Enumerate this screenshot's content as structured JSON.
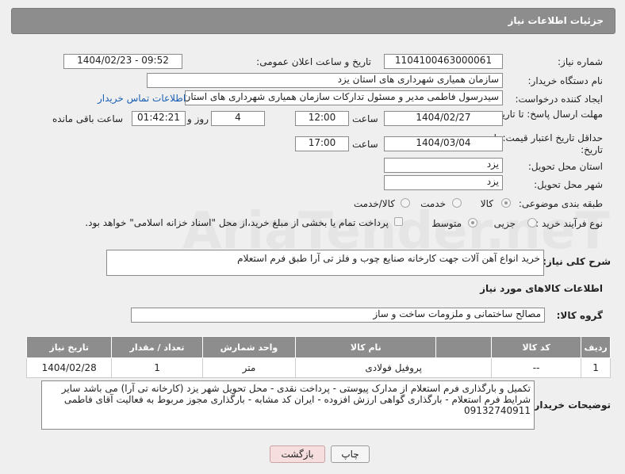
{
  "header": {
    "title": "جزئیات اطلاعات نیاز"
  },
  "watermark": "AriaTender.neT",
  "fields": {
    "need_number_label": "شماره نیاز:",
    "need_number": "1104100463000061",
    "announce_label": "تاریخ و ساعت اعلان عمومی:",
    "announce_value": "1404/02/23 - 09:52",
    "buyer_org_label": "نام دستگاه خریدار:",
    "buyer_org": "سازمان همیاری شهرداری های استان یزد",
    "creator_label": "ایجاد کننده درخواست:",
    "creator": "سیدرسول فاطمی مدیر و مسئول تدارکات سازمان همیاری شهرداری های استان",
    "contact_link": "اطلاعات تماس خریدار",
    "reply_deadline_label": "مهلت ارسال پاسخ: تا تاریخ:",
    "reply_date": "1404/02/27",
    "time_label": "ساعت",
    "reply_time": "12:00",
    "days_value": "4",
    "days_label": "روز و",
    "remaining_time": "01:42:21",
    "remaining_label": "ساعت باقی مانده",
    "price_deadline_label": "حداقل تاریخ اعتبار قیمت: تا تاریخ:",
    "price_date": "1404/03/04",
    "price_time": "17:00",
    "province_label": "استان محل تحویل:",
    "province": "یزد",
    "city_label": "شهر محل تحویل:",
    "city": "یزد",
    "category_label": "طبقه بندی موضوعی:",
    "category_options": [
      "کالا",
      "خدمت",
      "کالا/خدمت"
    ],
    "process_label": "نوع فرآیند خرید :",
    "process_options": [
      "جزیی",
      "متوسط"
    ],
    "payment_note": "پرداخت تمام یا بخشی از مبلغ خرید،از محل \"اسناد خزانه اسلامی\" خواهد بود.",
    "summary_label": "شرح کلی نیاز:",
    "summary": "خرید انواع آهن آلات جهت کارخانه صنایع چوب و فلز تی آرا طبق فرم استعلام",
    "goods_info_title": "اطلاعات کالاهای مورد نیاز",
    "goods_group_label": "گروه کالا:",
    "goods_group": "مصالح ساختمانی و ملزومات ساخت و ساز",
    "buyer_notes_label": "توضیحات خریدار:",
    "buyer_notes": "تکمیل و بارگذاری فرم استعلام از مدارک پیوستی - پرداخت نقدی - محل تحویل شهر یزد (کارخانه تی آرا) می باشد سایر شرایط فرم استعلام - بارگذاری گواهی ارزش افزوده - ایران کد مشابه - بارگذاری مجوز مربوط به فعالیت آقای فاطمی 09132740911"
  },
  "table": {
    "headers": [
      "ردیف",
      "کد کالا",
      "نام کالا",
      "واحد شمارش",
      "تعداد / مقدار",
      "تاریخ نیاز"
    ],
    "rows": [
      [
        "1",
        "--",
        "پروفیل فولادی",
        "متر",
        "1",
        "1404/02/28"
      ]
    ]
  },
  "buttons": {
    "print": "چاپ",
    "back": "بازگشت"
  }
}
